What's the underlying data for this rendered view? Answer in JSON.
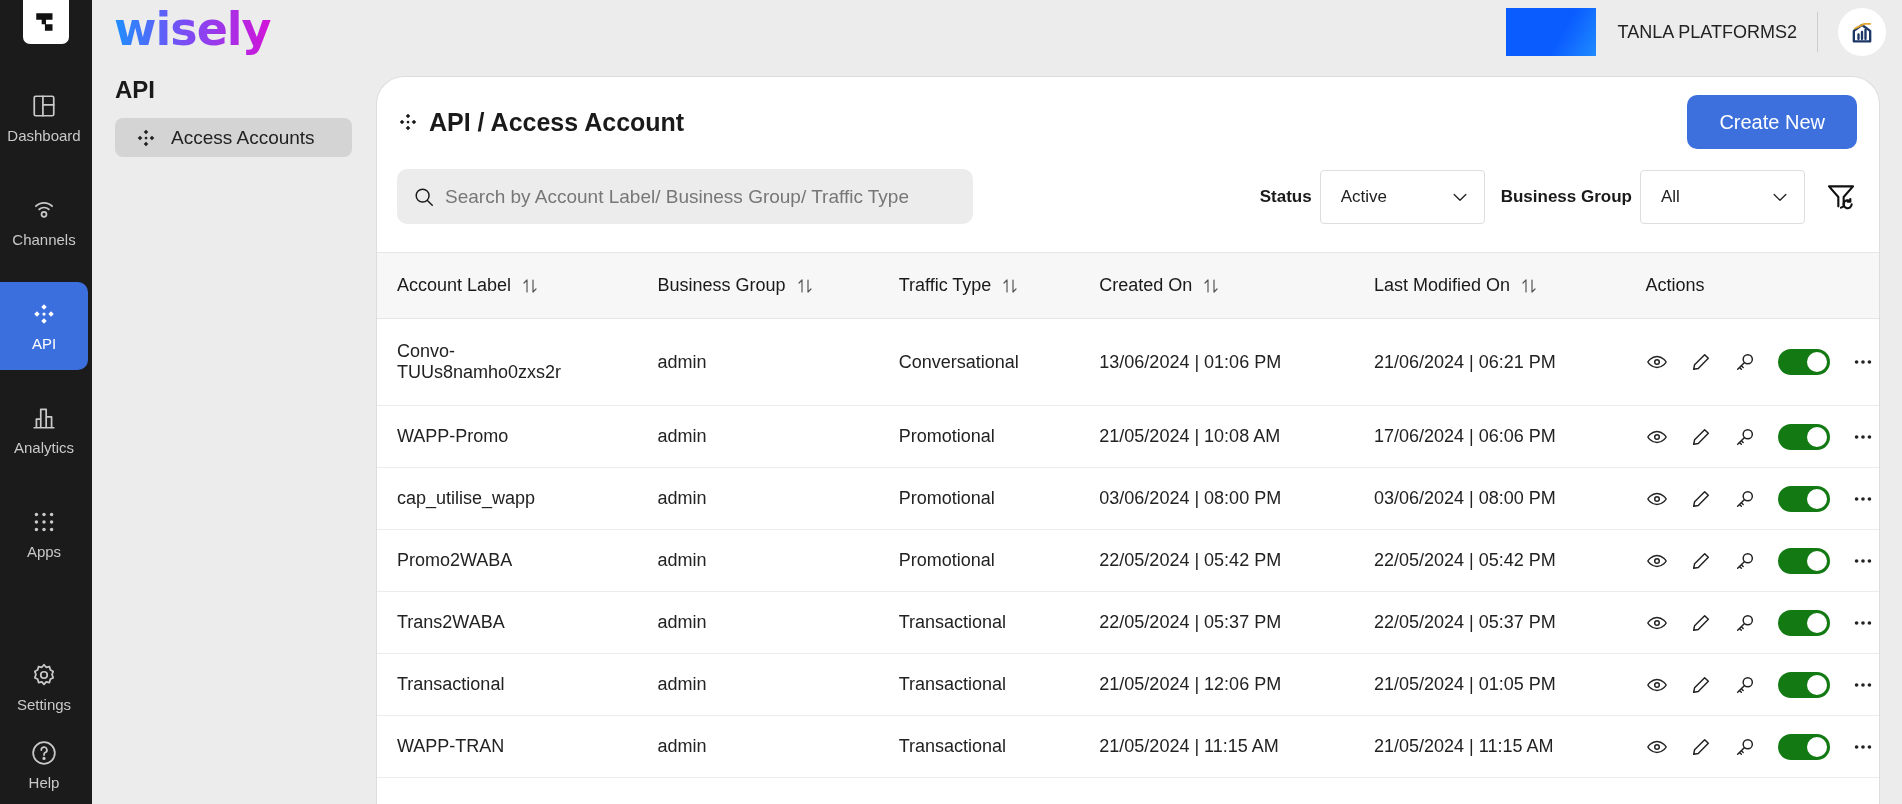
{
  "sidebar": {
    "items": [
      {
        "label": "Dashboard",
        "selected": false
      },
      {
        "label": "Channels",
        "selected": false
      },
      {
        "label": "API",
        "selected": true
      },
      {
        "label": "Analytics",
        "selected": false
      },
      {
        "label": "Apps",
        "selected": false
      }
    ],
    "bottom_items": [
      {
        "label": "Settings",
        "selected": false
      },
      {
        "label": "Help",
        "selected": false
      }
    ]
  },
  "header": {
    "brand": "wisely",
    "account": "TANLA PLATFORMS2"
  },
  "subnav": {
    "title": "API",
    "items": [
      {
        "label": "Access Accounts",
        "selected": true
      }
    ]
  },
  "page": {
    "title": "API / Access Account",
    "create_button": "Create New",
    "search": {
      "placeholder": "Search by Account Label/ Business Group/ Traffic Type"
    },
    "filters": [
      {
        "label": "Status",
        "value": "Active"
      },
      {
        "label": "Business Group",
        "value": "All"
      }
    ]
  },
  "table": {
    "columns": [
      {
        "label": "Account Label",
        "sortable": true
      },
      {
        "label": "Business Group",
        "sortable": true
      },
      {
        "label": "Traffic Type",
        "sortable": true
      },
      {
        "label": "Created On",
        "sortable": true
      },
      {
        "label": "Last Modified On",
        "sortable": true
      },
      {
        "label": "Actions",
        "sortable": false
      }
    ],
    "rows": [
      {
        "account_label": "Convo-TUUs8namho0zxs2r",
        "business_group": "admin",
        "traffic_type": "Conversational",
        "created_on": "13/06/2024 | 01:06 PM",
        "last_modified_on": "21/06/2024 | 06:21 PM",
        "enabled": true
      },
      {
        "account_label": "WAPP-Promo",
        "business_group": "admin",
        "traffic_type": "Promotional",
        "created_on": "21/05/2024 | 10:08 AM",
        "last_modified_on": "17/06/2024 | 06:06 PM",
        "enabled": true
      },
      {
        "account_label": "cap_utilise_wapp",
        "business_group": "admin",
        "traffic_type": "Promotional",
        "created_on": "03/06/2024 | 08:00 PM",
        "last_modified_on": "03/06/2024 | 08:00 PM",
        "enabled": true
      },
      {
        "account_label": "Promo2WABA",
        "business_group": "admin",
        "traffic_type": "Promotional",
        "created_on": "22/05/2024 | 05:42 PM",
        "last_modified_on": "22/05/2024 | 05:42 PM",
        "enabled": true
      },
      {
        "account_label": "Trans2WABA",
        "business_group": "admin",
        "traffic_type": "Transactional",
        "created_on": "22/05/2024 | 05:37 PM",
        "last_modified_on": "22/05/2024 | 05:37 PM",
        "enabled": true
      },
      {
        "account_label": "Transactional",
        "business_group": "admin",
        "traffic_type": "Transactional",
        "created_on": "21/05/2024 | 12:06 PM",
        "last_modified_on": "21/05/2024 | 01:05 PM",
        "enabled": true
      },
      {
        "account_label": "WAPP-TRAN",
        "business_group": "admin",
        "traffic_type": "Transactional",
        "created_on": "21/05/2024 | 11:15 AM",
        "last_modified_on": "21/05/2024 | 11:15 AM",
        "enabled": true
      }
    ]
  }
}
